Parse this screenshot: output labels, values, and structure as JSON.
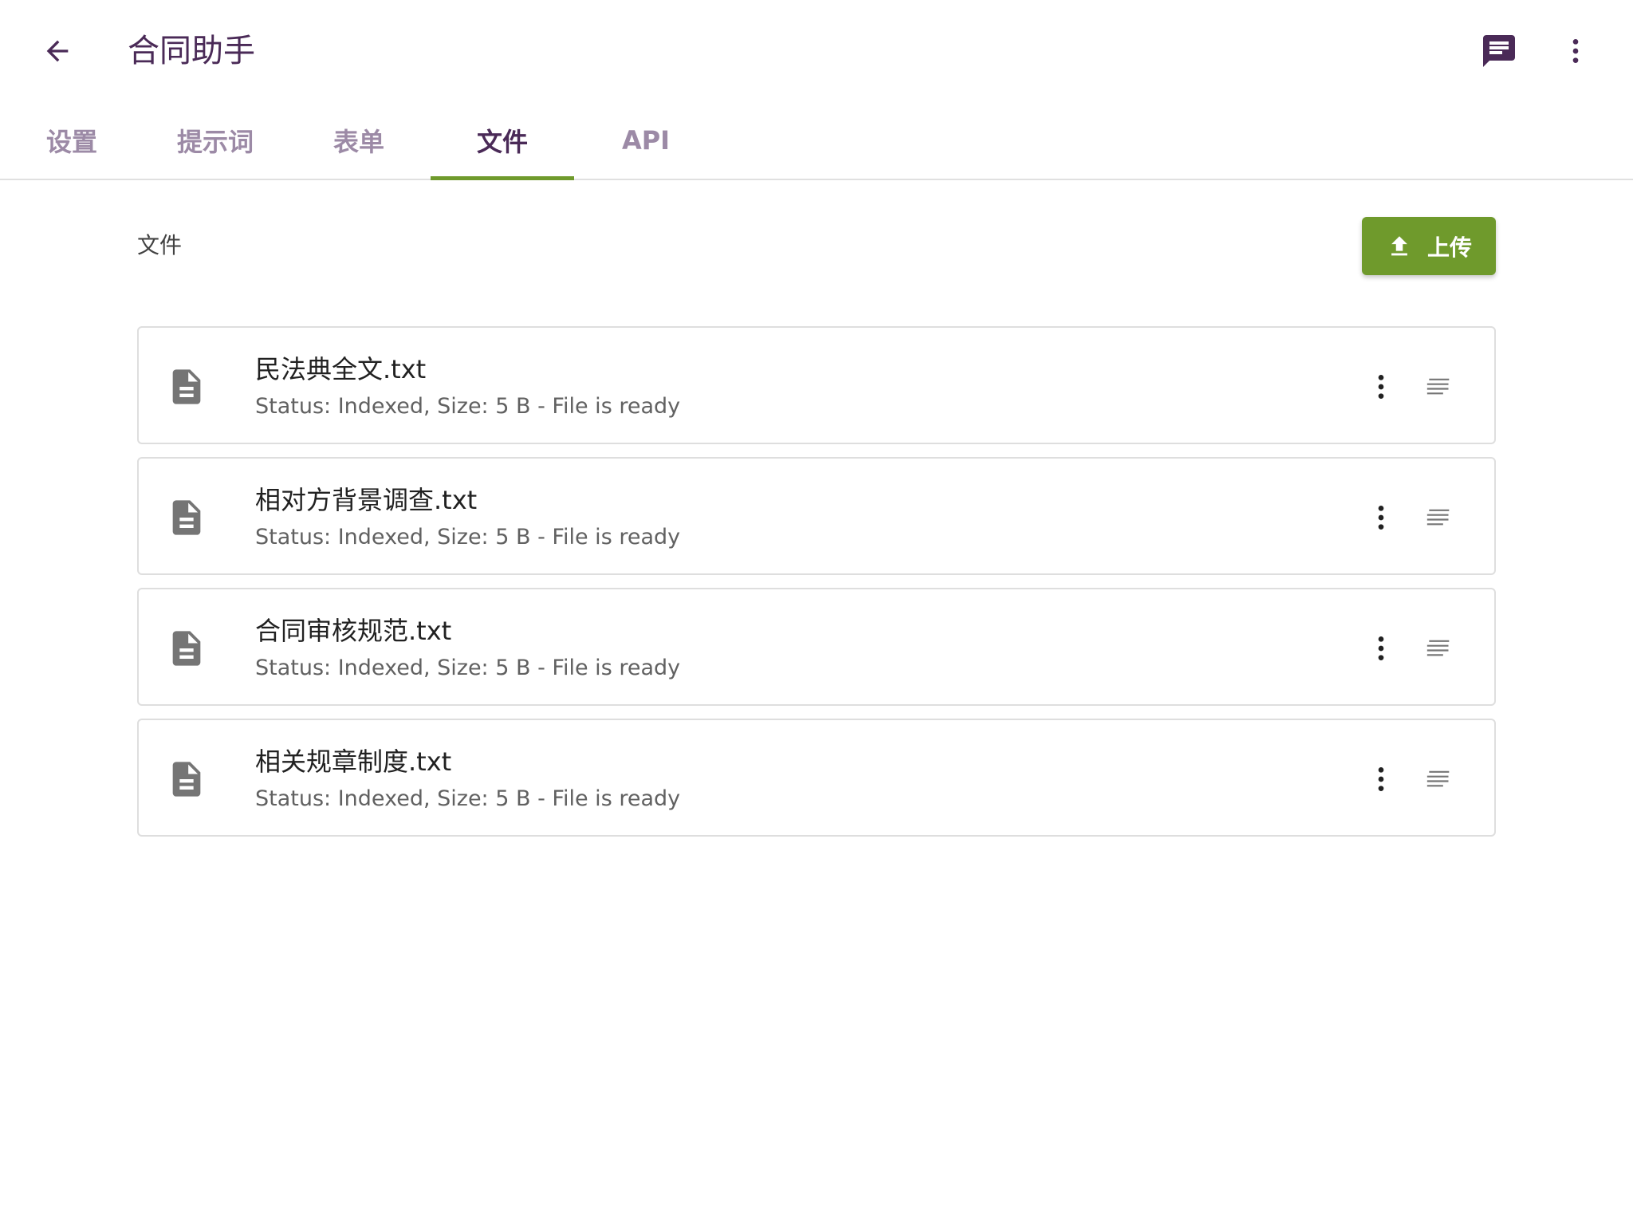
{
  "header": {
    "title": "合同助手",
    "back_icon": "arrow-left-icon",
    "chat_icon": "chat-icon",
    "more_icon": "more-vertical-icon"
  },
  "tabs": [
    {
      "label": "设置",
      "active": false
    },
    {
      "label": "提示词",
      "active": false
    },
    {
      "label": "表单",
      "active": false
    },
    {
      "label": "文件",
      "active": true
    },
    {
      "label": "API",
      "active": false
    }
  ],
  "files_section": {
    "label": "文件",
    "upload_label": "上传",
    "upload_icon": "upload-icon"
  },
  "files": [
    {
      "name": "民法典全文.txt",
      "status": "Status: Indexed, Size: 5 B - File is ready"
    },
    {
      "name": "相对方背景调查.txt",
      "status": "Status: Indexed, Size: 5 B - File is ready"
    },
    {
      "name": "合同审核规范.txt",
      "status": "Status: Indexed, Size: 5 B - File is ready"
    },
    {
      "name": "相关规章制度.txt",
      "status": "Status: Indexed, Size: 5 B - File is ready"
    }
  ],
  "colors": {
    "title": "#4a2a57",
    "accent": "#6f9a2c",
    "tab_inactive": "#9c8aa6"
  }
}
